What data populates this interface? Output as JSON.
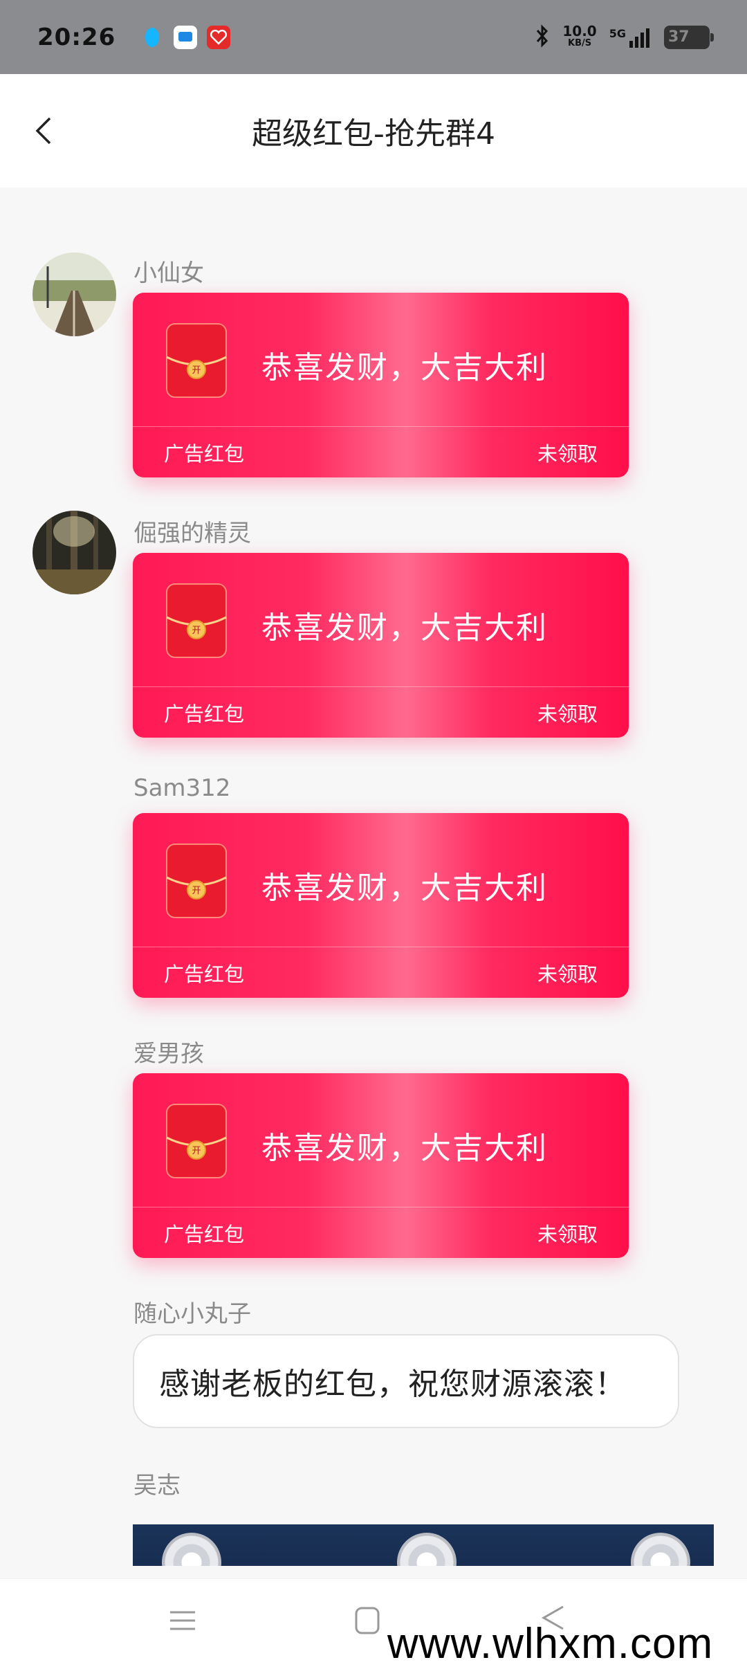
{
  "status_bar": {
    "time": "20:26",
    "net_speed_value": "10.0",
    "net_speed_unit": "KB/S",
    "network": "5G",
    "battery": "37",
    "app_icons": [
      "qq-icon",
      "message-icon",
      "taobao-icon"
    ]
  },
  "header": {
    "title": "超级红包-抢先群4"
  },
  "messages": [
    {
      "type": "red_packet",
      "sender": "小仙女",
      "greeting": "恭喜发财，大吉大利",
      "label": "广告红包",
      "status": "未领取",
      "avatar": "railway-avatar"
    },
    {
      "type": "red_packet",
      "sender": "倔强的精灵",
      "greeting": "恭喜发财，大吉大利",
      "label": "广告红包",
      "status": "未领取",
      "avatar": "forest-avatar"
    },
    {
      "type": "red_packet",
      "sender": "Sam312",
      "greeting": "恭喜发财，大吉大利",
      "label": "广告红包",
      "status": "未领取"
    },
    {
      "type": "red_packet",
      "sender": "爱男孩",
      "greeting": "恭喜发财，大吉大利",
      "label": "广告红包",
      "status": "未领取"
    },
    {
      "type": "text",
      "sender": "随心小丸子",
      "text": "感谢老板的红包，祝您财源滚滚！"
    },
    {
      "type": "image",
      "sender": "吴志"
    }
  ],
  "red_packet_icon_char": "开",
  "watermark": "www.wlhxm.com",
  "colors": {
    "accent": "#ff1a55",
    "status_bar_bg": "#8b8c8f",
    "page_bg": "#f7f7f8"
  }
}
